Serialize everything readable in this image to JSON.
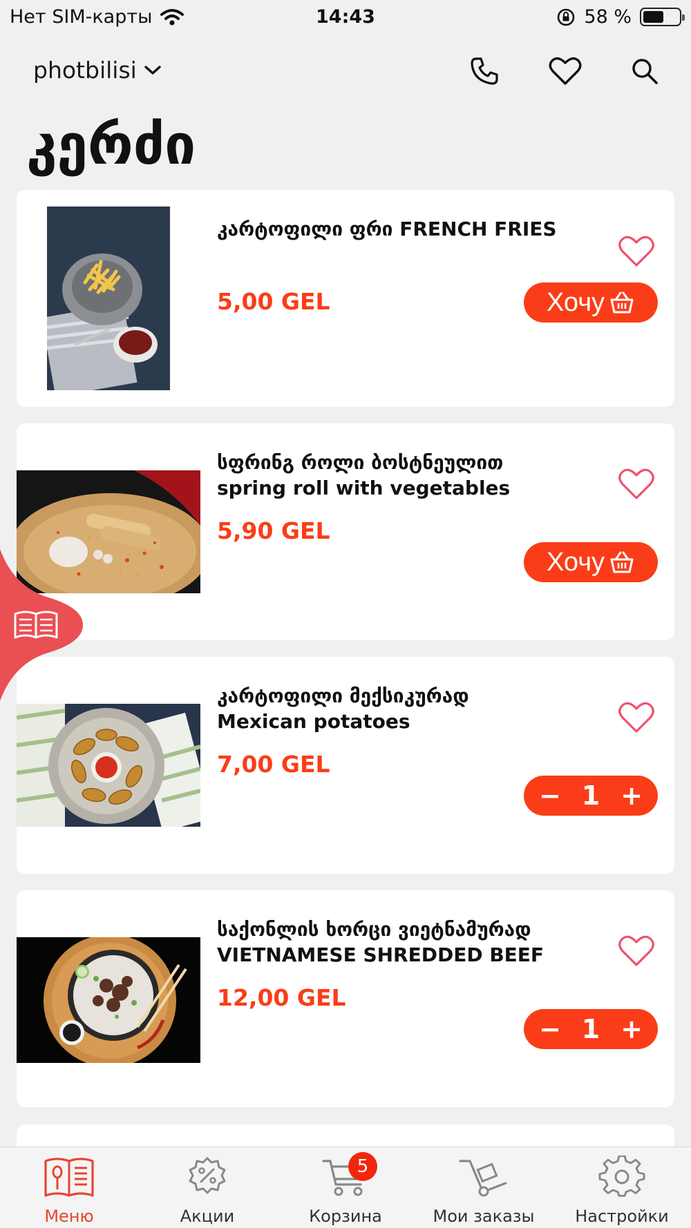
{
  "status_bar": {
    "carrier": "Нет SIM-карты",
    "time": "14:43",
    "battery_percent": "58 %",
    "battery_level": 0.58
  },
  "header": {
    "city": "photbilisi"
  },
  "page_title": "კერძი",
  "products": [
    {
      "name_line1": "კარტოფილი ფრი FRENCH FRIES",
      "name_line2": "",
      "price": "5,00 GEL",
      "action": "want",
      "want_label": "Хочу"
    },
    {
      "name_line1": "სფრინგ როლი ბოსტნეულით",
      "name_line2": "spring roll with vegetables",
      "price": "5,90 GEL",
      "action": "want",
      "want_label": "Хочу"
    },
    {
      "name_line1": "კარტოფილი მექსიკურად",
      "name_line2": "Mexican potatoes",
      "price": "7,00 GEL",
      "action": "stepper",
      "quantity": "1",
      "minus": "−",
      "plus": "+"
    },
    {
      "name_line1": "საქონლის ხორცი ვიეტნამურად",
      "name_line2": "VIETNAMESE SHREDDED BEEF",
      "price": "12,00 GEL",
      "action": "stepper",
      "quantity": "1",
      "minus": "−",
      "plus": "+"
    }
  ],
  "bottom_nav": {
    "items": [
      {
        "label": "Меню",
        "icon": "menu-book-icon",
        "active": true
      },
      {
        "label": "Акции",
        "icon": "discount-gear-icon",
        "active": false
      },
      {
        "label": "Корзина",
        "icon": "cart-icon",
        "active": false
      },
      {
        "label": "Мои заказы",
        "icon": "hand-truck-icon",
        "active": false
      },
      {
        "label": "Настройки",
        "icon": "settings-gear-icon",
        "active": false
      }
    ],
    "cart_badge": "5"
  },
  "colors": {
    "accent": "#fa3d18",
    "heart": "#f0506e",
    "side_tab": "#ea4f53",
    "active_nav": "#e8452f"
  }
}
